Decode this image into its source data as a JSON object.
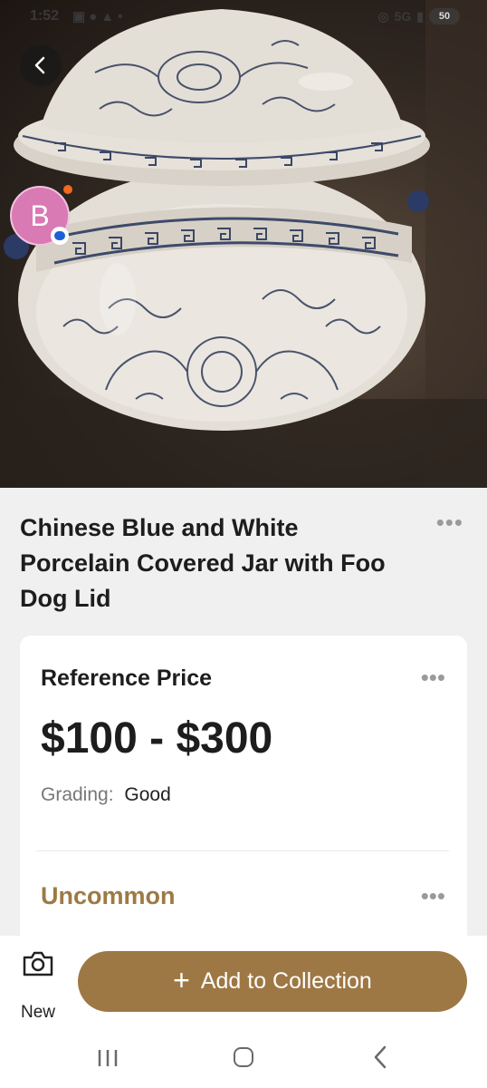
{
  "status_bar": {
    "time": "1:52",
    "left_icons": [
      "screenshot-icon",
      "messenger-icon",
      "alert-icon"
    ],
    "network": "5G",
    "battery": "50"
  },
  "hero": {
    "image": "blue and white porcelain covered jar photo"
  },
  "avatar": {
    "initial": "B",
    "color": "#d97ab4"
  },
  "item": {
    "title": "Chinese Blue and White Porcelain Covered Jar with Foo Dog Lid"
  },
  "price_card": {
    "title": "Reference Price",
    "price": "$100 - $300",
    "grading_label": "Grading:",
    "grading_value": "Good",
    "rarity": "Uncommon"
  },
  "more_glyph": "•••",
  "actions": {
    "new_label": "New",
    "add_plus": "+",
    "add_label": "Add to Collection"
  },
  "colors": {
    "accent": "#9e7844",
    "rarity": "#9c7a45",
    "background": "#f0f0f0"
  }
}
